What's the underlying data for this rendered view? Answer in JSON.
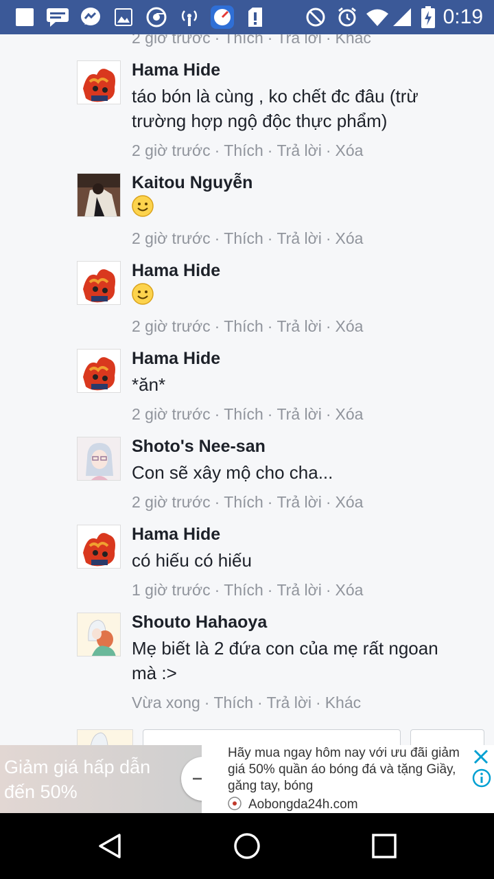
{
  "status_bar": {
    "time": "0:19",
    "icons": [
      "square-notification-icon",
      "messages-icon",
      "messenger-icon",
      "gallery-icon",
      "chrome-icon",
      "hotspot-icon",
      "speed-app-icon",
      "sd-card-alert-icon",
      "do-not-disturb-icon",
      "alarm-icon",
      "wifi-icon",
      "signal-icon",
      "battery-charging-icon"
    ]
  },
  "top_partial_meta": {
    "time": "2 giờ trước",
    "like": "Thích",
    "reply": "Trả lời",
    "more": "Khác"
  },
  "comments": [
    {
      "author": "Hama Hide",
      "text": "táo bón là cùng , ko chết đc đâu (trừ trường hợp ngộ độc thực phẩm)",
      "time": "2 giờ trước",
      "like": "Thích",
      "reply": "Trả lời",
      "action": "Xóa"
    },
    {
      "author": "Kaitou Nguyễn",
      "emoji": "smile-emoji",
      "time": "2 giờ trước",
      "like": "Thích",
      "reply": "Trả lời",
      "action": "Xóa"
    },
    {
      "author": "Hama Hide",
      "emoji": "smile-emoji",
      "time": "2 giờ trước",
      "like": "Thích",
      "reply": "Trả lời",
      "action": "Xóa"
    },
    {
      "author": "Hama Hide",
      "text": "*ăn*",
      "time": "2 giờ trước",
      "like": "Thích",
      "reply": "Trả lời",
      "action": "Xóa"
    },
    {
      "author": "Shoto's Nee-san",
      "text": "Con sẽ xây mộ cho cha...",
      "time": "2 giờ trước",
      "like": "Thích",
      "reply": "Trả lời",
      "action": "Xóa"
    },
    {
      "author": "Hama Hide",
      "text": "có hiếu có hiếu",
      "time": "1 giờ trước",
      "like": "Thích",
      "reply": "Trả lời",
      "action": "Xóa"
    },
    {
      "author": "Shouto Hahaoya",
      "text": "Mẹ biết là 2 đứa con của mẹ rất ngoan mà :>",
      "time": "Vừa xong",
      "like": "Thích",
      "reply": "Trả lời",
      "action": "Khác"
    }
  ],
  "ad": {
    "headline": "Giảm giá hấp dẫn đến 50%",
    "body": "Hãy mua ngay hôm nay với ưu đãi giảm giá 50% quần áo bóng đá và tặng Giầy, găng tay, bóng",
    "domain": "Aobongda24h.com",
    "colors": {
      "accent": "#00a0d2"
    }
  },
  "theme": {
    "status_bar": "#3b5998",
    "meta_text": "#90949c",
    "name_text": "#1d2129"
  }
}
